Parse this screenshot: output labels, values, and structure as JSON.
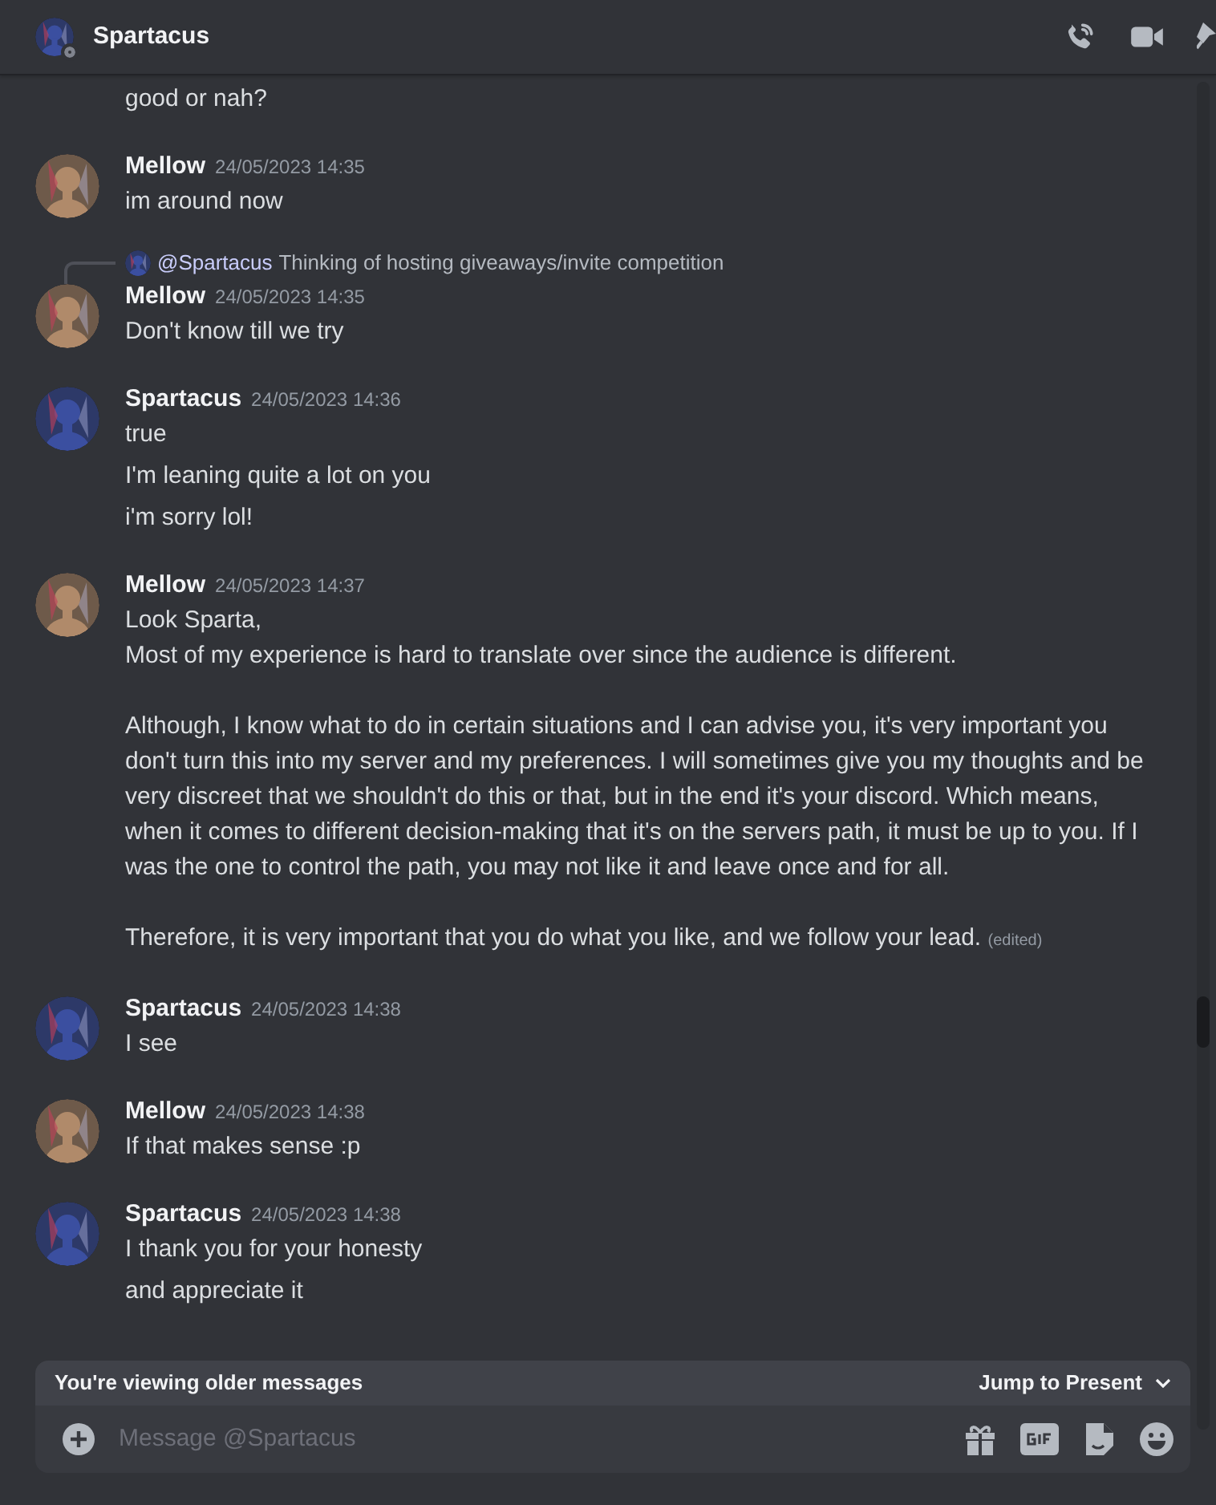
{
  "header": {
    "title": "Spartacus",
    "online": false
  },
  "messages": [
    {
      "kind": "continuation",
      "lines": [
        "good or nah?"
      ]
    },
    {
      "kind": "group",
      "author": "Mellow",
      "timestamp": "24/05/2023 14:35",
      "color": "#b08a6a",
      "lines": [
        "im around now"
      ]
    },
    {
      "kind": "group",
      "author": "Mellow",
      "timestamp": "24/05/2023 14:35",
      "color": "#b08a6a",
      "reply": {
        "mention": "@Spartacus",
        "text": "Thinking of hosting giveaways/invite competition",
        "color": "#3b4fa0"
      },
      "lines": [
        "Don't know till we try"
      ]
    },
    {
      "kind": "group",
      "author": "Spartacus",
      "timestamp": "24/05/2023 14:36",
      "color": "#3b4fa0",
      "lines": [
        "true",
        "I'm leaning quite a lot on you",
        "i'm sorry lol!"
      ]
    },
    {
      "kind": "group",
      "author": "Mellow",
      "timestamp": "24/05/2023 14:37",
      "color": "#b08a6a",
      "lines": [
        "Look Sparta,\nMost of my experience is hard to translate over since the audience is different.\n\nAlthough, I know what to do in certain situations and I can advise you, it's very important you don't turn this into my server and my preferences. I will sometimes give you my thoughts and be very discreet that we shouldn't do this or that, but in the end it's your discord. Which means, when it comes to different decision-making that it's on the servers path, it must be up to you. If I was the one to control the path, you may not like it and leave once and for all.\n\nTherefore, it is very important that you do what you like, and we follow your lead."
      ],
      "edited": "(edited)"
    },
    {
      "kind": "group",
      "author": "Spartacus",
      "timestamp": "24/05/2023 14:38",
      "color": "#3b4fa0",
      "lines": [
        "I see"
      ]
    },
    {
      "kind": "group",
      "author": "Mellow",
      "timestamp": "24/05/2023 14:38",
      "color": "#b08a6a",
      "lines": [
        "If that makes sense :p"
      ]
    },
    {
      "kind": "group",
      "author": "Spartacus",
      "timestamp": "24/05/2023 14:38",
      "color": "#3b4fa0",
      "lines": [
        "I thank you for your honesty",
        "and appreciate it"
      ]
    }
  ],
  "banner": {
    "text": "You're viewing older messages",
    "action": "Jump to Present"
  },
  "composer": {
    "placeholder": "Message @Spartacus"
  }
}
